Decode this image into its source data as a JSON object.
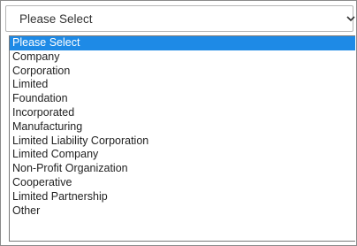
{
  "select": {
    "value": "Please Select"
  },
  "icons": {
    "dropdown": "chevron-down-icon"
  },
  "colors": {
    "highlight": "#1e8ae6",
    "border": "#b5b5b5"
  },
  "options": [
    "Please Select",
    "Company",
    "Corporation",
    "Limited",
    "Foundation",
    "Incorporated",
    "Manufacturing",
    "Limited Liability Corporation",
    "Limited Company",
    "Non-Profit Organization",
    "Cooperative",
    "Limited Partnership",
    "Other"
  ],
  "selected_index": 0
}
